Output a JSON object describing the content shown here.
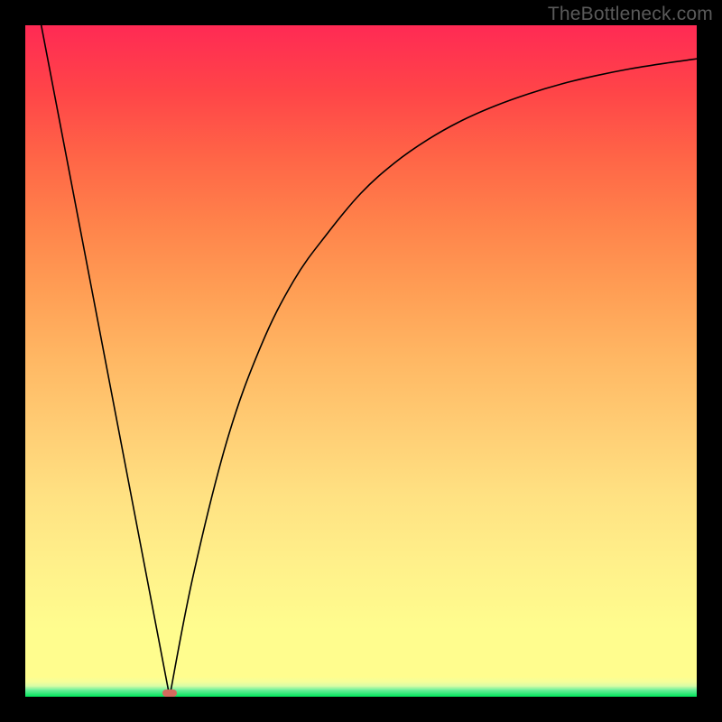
{
  "watermark": "TheBottleneck.com",
  "chart_data": {
    "type": "line",
    "title": "",
    "xlabel": "",
    "ylabel": "",
    "xlim": [
      0,
      100
    ],
    "ylim": [
      0,
      100
    ],
    "grid": false,
    "legend": false,
    "series": [
      {
        "name": "left-branch",
        "x": [
          2,
          21.5
        ],
        "y": [
          102,
          0
        ]
      },
      {
        "name": "right-branch",
        "x": [
          21.5,
          25,
          30,
          35,
          40,
          45,
          50,
          55,
          60,
          65,
          70,
          75,
          80,
          85,
          90,
          95,
          100
        ],
        "y": [
          0,
          18,
          38,
          52,
          62,
          69,
          75,
          79.5,
          83,
          85.8,
          88,
          89.8,
          91.3,
          92.5,
          93.5,
          94.3,
          95
        ]
      }
    ],
    "marker": {
      "x": 21.5,
      "y": 0.6
    },
    "gradient_stops": [
      {
        "pos": 0.0,
        "color": "#00e55c"
      },
      {
        "pos": 0.016,
        "color": "#d8fca6"
      },
      {
        "pos": 0.03,
        "color": "#fffd8e"
      },
      {
        "pos": 0.5,
        "color": "#ffb864"
      },
      {
        "pos": 1.0,
        "color": "#ff2a54"
      }
    ]
  }
}
